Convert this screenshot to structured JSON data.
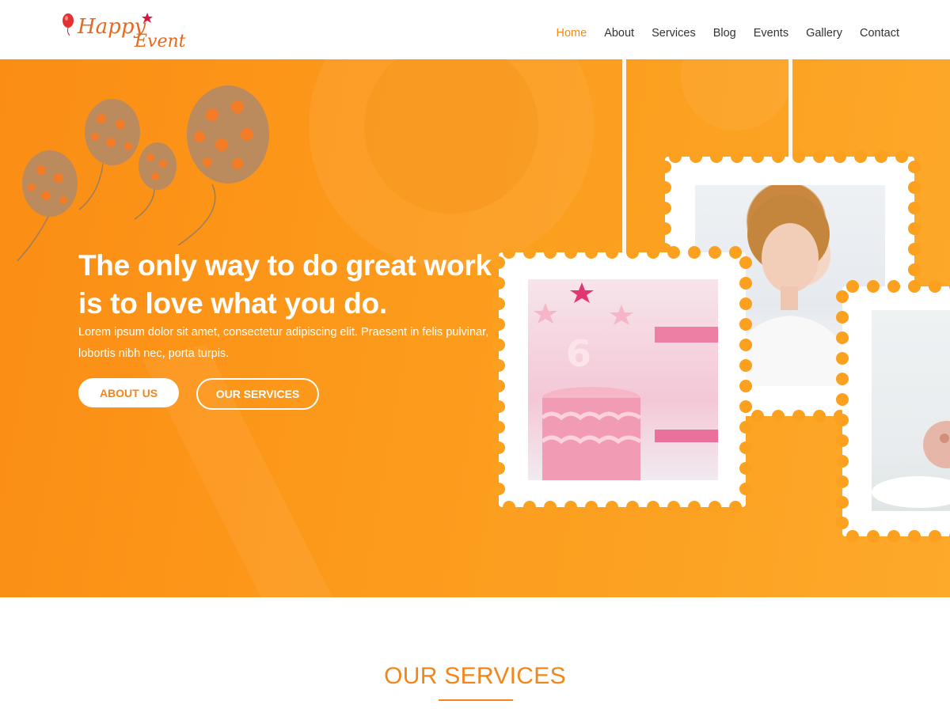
{
  "brand": {
    "logo_text_line1": "Happy",
    "logo_text_line2": "Event",
    "logo_color": "#e8681f",
    "star_color": "#d9173e"
  },
  "nav": {
    "items": [
      {
        "label": "Home",
        "active": true
      },
      {
        "label": "About",
        "active": false
      },
      {
        "label": "Services",
        "active": false
      },
      {
        "label": "Blog",
        "active": false
      },
      {
        "label": "Events",
        "active": false
      },
      {
        "label": "Gallery",
        "active": false
      },
      {
        "label": "Contact",
        "active": false
      }
    ],
    "active_color": "#f28a1c"
  },
  "hero": {
    "title_line1": "The only way to do great work",
    "title_line2": "is to love what you do.",
    "text_line1": "Lorem ipsum dolor sit amet, consectetur adipiscing elit. Praesent in felis pulvinar,",
    "text_line2": "lobortis nibh nec, porta turpis.",
    "primary_button": "ABOUT US",
    "secondary_button": "OUR SERVICES",
    "background_color": "#fc9b1c"
  },
  "services": {
    "title": "OUR SERVICES",
    "accent": "#f2861a"
  },
  "icons": {
    "logo": "balloon-star-logo",
    "balloons": "balloon-icon"
  }
}
